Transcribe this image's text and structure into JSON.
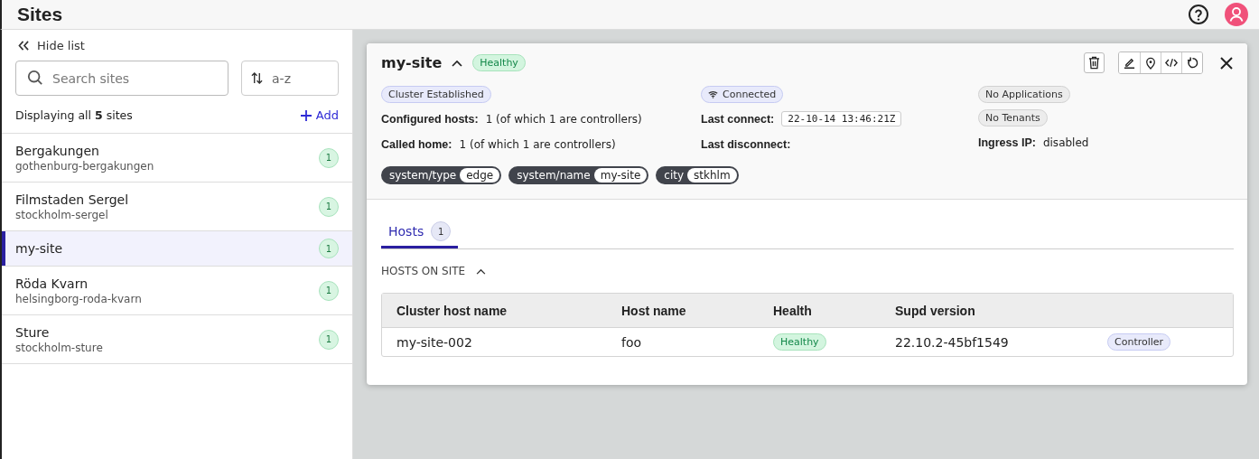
{
  "header": {
    "title": "Sites"
  },
  "sidebar": {
    "hide_label": "Hide list",
    "search": {
      "placeholder": "Search sites"
    },
    "sort": {
      "value": "a-z"
    },
    "summary": "Displaying all **5** sites",
    "add_label": "Add",
    "items": [
      {
        "name": "Bergakungen",
        "slug": "gothenburg-bergakungen",
        "count": "1",
        "selected": false
      },
      {
        "name": "Filmstaden Sergel",
        "slug": "stockholm-sergel",
        "count": "1",
        "selected": false
      },
      {
        "name": "my-site",
        "count": "1",
        "selected": true
      },
      {
        "name": "Röda Kvarn",
        "slug": "helsingborg-roda-kvarn",
        "count": "1",
        "selected": false
      },
      {
        "name": "Sture",
        "slug": "stockholm-sture",
        "count": "1",
        "selected": false
      }
    ]
  },
  "detail": {
    "title": "my-site",
    "expanded": true,
    "status": "Healthy",
    "columns": [
      [
        {
          "kind": "info_badge",
          "text": "Cluster Established"
        },
        {
          "kind": "field",
          "label": "Configured hosts:",
          "value": "1 (of which 1 are controllers)"
        },
        {
          "kind": "field",
          "label": "Called home:",
          "value": "1 (of which 1 are controllers)"
        }
      ],
      [
        {
          "kind": "connection_badge",
          "text": "Connected"
        },
        {
          "kind": "timestamp",
          "label": "Last connect:",
          "value": "22-10-14 13:46:21Z"
        },
        {
          "kind": "field",
          "label": "Last disconnect:"
        }
      ],
      [
        {
          "kind": "neutral_badge",
          "text": "No Applications"
        },
        {
          "kind": "neutral_badge",
          "text": "No Tenants"
        },
        {
          "kind": "field",
          "label": "Ingress IP:",
          "value": "disabled"
        }
      ]
    ],
    "labels": [
      {
        "key": "system/type",
        "value": "edge"
      },
      {
        "key": "system/name",
        "value": "my-site"
      },
      {
        "key": "city",
        "value": "stkhlm"
      }
    ],
    "tabs": [
      {
        "label": "Hosts",
        "count": "1",
        "selected": true
      }
    ],
    "section": {
      "title": "HOSTS ON SITE",
      "expanded": true
    },
    "table": {
      "columns": [
        "Cluster host name",
        "Host name",
        "Health",
        "Supd version"
      ],
      "rows": [
        {
          "cells": [
            "my-site-002",
            "foo",
            "Healthy",
            "22.10.2-45bf1549",
            "Controller"
          ]
        }
      ]
    }
  }
}
